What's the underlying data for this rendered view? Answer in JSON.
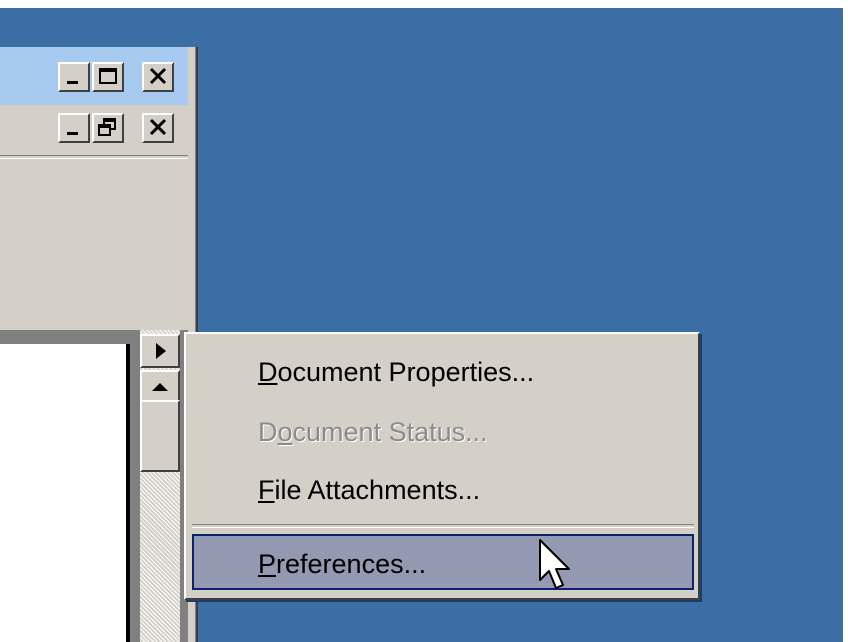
{
  "window": {
    "caption_buttons": [
      {
        "name": "minimize-button",
        "icon": "minimize-icon"
      },
      {
        "name": "maximize-button",
        "icon": "maximize-icon"
      },
      {
        "name": "close-button",
        "icon": "close-icon"
      }
    ],
    "document_caption_buttons": [
      {
        "name": "doc-minimize-button",
        "icon": "minimize-icon"
      },
      {
        "name": "doc-restore-button",
        "icon": "restore-icon"
      },
      {
        "name": "doc-close-button",
        "icon": "close-icon"
      }
    ]
  },
  "context_menu": {
    "items": [
      {
        "label": "Document Properties...",
        "mnemonic": "D",
        "enabled": true,
        "highlighted": false
      },
      {
        "label": "Document Status...",
        "mnemonic": "o",
        "enabled": false,
        "highlighted": false
      },
      {
        "label": "File Attachments...",
        "mnemonic": "F",
        "enabled": true,
        "highlighted": false
      },
      {
        "label": "Preferences...",
        "mnemonic": "P",
        "enabled": true,
        "highlighted": true
      }
    ]
  },
  "colors": {
    "desktop": "#3a6ea5",
    "title_bar": "#a6caf0",
    "face": "#d4d0c8",
    "highlight": "#9499b2",
    "disabled_text": "#8b8b8b"
  }
}
